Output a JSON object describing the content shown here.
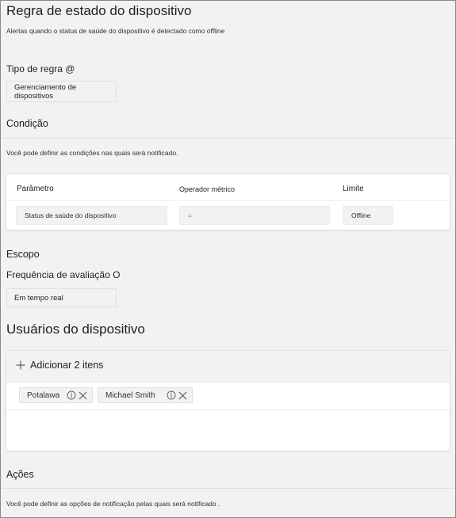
{
  "page": {
    "title": "Regra de estado do dispositivo",
    "subtitle": "Alertas quando o status de saúde do dispositivo é detectado como offline"
  },
  "rule_type": {
    "label": "Tipo de regra @",
    "value": "Gerenciamento de dispositivos"
  },
  "condition": {
    "label": "Condição",
    "description": "Você pode definir as condições nas quais será notificado.",
    "columns": [
      "Parâmetro",
      "Operador métrico",
      "Limite"
    ],
    "row": {
      "parameter": "Status de saúde do dispositivo",
      "operator": "=",
      "limit": "Offline"
    }
  },
  "scope": {
    "label": "Escopo",
    "frequency_label": "Frequência de avaliação O",
    "frequency_value": "Em tempo real"
  },
  "device_users": {
    "label": "Usuários do dispositivo",
    "add_label": "Adicionar 2 itens",
    "items": [
      {
        "name": "Potalawa"
      },
      {
        "name": "Michael Smith"
      }
    ]
  },
  "actions": {
    "label": "Ações",
    "description": "Você pode definir as opções de notificação pelas quais será notificado ."
  },
  "icons": {
    "add": "plus-icon",
    "info": "info-icon",
    "remove": "close-icon"
  }
}
